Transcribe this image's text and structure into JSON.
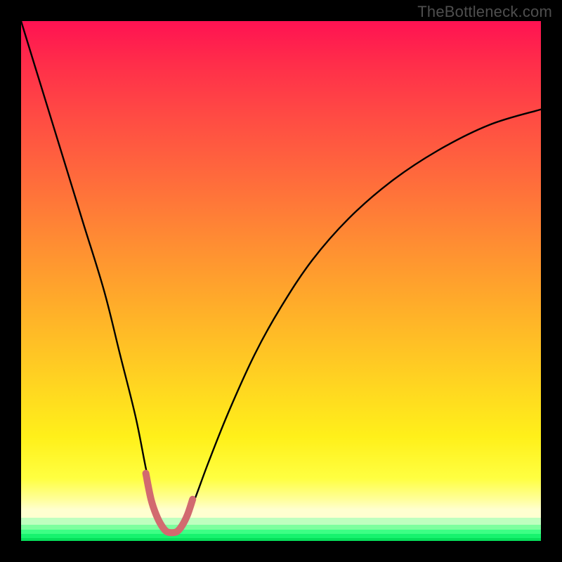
{
  "watermark": "TheBottleneck.com",
  "chart_data": {
    "type": "line",
    "title": "",
    "xlabel": "",
    "ylabel": "",
    "xlim": [
      0,
      100
    ],
    "ylim": [
      0,
      100
    ],
    "background_gradient": {
      "direction": "vertical",
      "stops": [
        {
          "pos": 0,
          "color": "#ff1252"
        },
        {
          "pos": 18,
          "color": "#ff4a44"
        },
        {
          "pos": 42,
          "color": "#ff8b33"
        },
        {
          "pos": 68,
          "color": "#ffd022"
        },
        {
          "pos": 88,
          "color": "#ffff41"
        },
        {
          "pos": 94,
          "color": "#ffffd0"
        },
        {
          "pos": 96,
          "color": "#bfffbf"
        },
        {
          "pos": 100,
          "color": "#06de5a"
        }
      ]
    },
    "series": [
      {
        "name": "bottleneck-curve",
        "stroke": "#000000",
        "x": [
          0,
          4,
          8,
          12,
          16,
          19,
          22,
          24,
          25.5,
          27,
          28,
          29.5,
          31,
          33,
          36,
          40,
          45,
          50,
          56,
          63,
          71,
          80,
          90,
          100
        ],
        "y": [
          100,
          87,
          74,
          61,
          48,
          36,
          24,
          14,
          7,
          3,
          1.5,
          1.5,
          3,
          7,
          15,
          25,
          36,
          45,
          54,
          62,
          69,
          75,
          80,
          83
        ]
      },
      {
        "name": "min-marker",
        "stroke": "#d26a6f",
        "stroke_width": 10,
        "x": [
          24,
          25,
          26,
          27,
          28,
          29,
          30,
          31,
          32,
          33
        ],
        "y": [
          13,
          8,
          5,
          3,
          1.8,
          1.6,
          1.8,
          3,
          5,
          8
        ]
      }
    ],
    "minimum": {
      "x": 28.5,
      "y": 1.5
    }
  }
}
